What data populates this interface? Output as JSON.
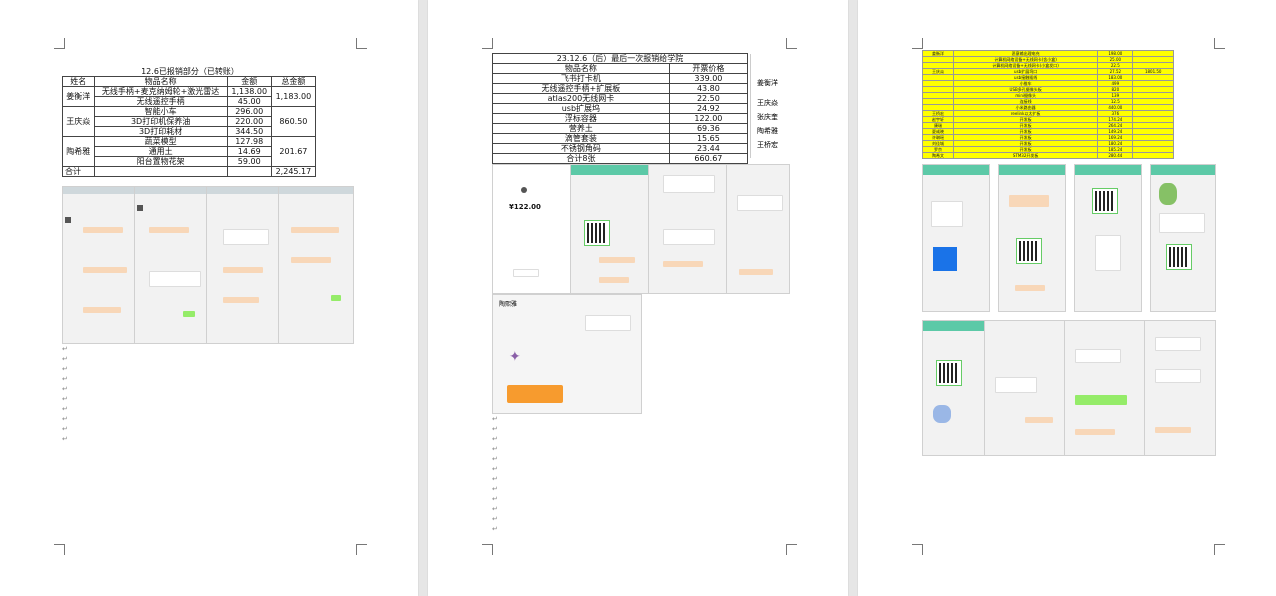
{
  "page1": {
    "caption": "12.6已报销部分（已转账）",
    "headers": [
      "姓名",
      "物品名称",
      "金额",
      "总金额"
    ],
    "rows": {
      "jiang": {
        "name": "姜衡洋",
        "items": [
          "无线手柄+麦克纳姆轮+激光雷达",
          "无线遥控手柄"
        ],
        "amounts": [
          "1,138.00",
          "45.00"
        ],
        "total": "1,183.00"
      },
      "wang": {
        "name": "王庆焱",
        "items": [
          "智能小车",
          "3D打印机保养油",
          "3D打印耗材"
        ],
        "amounts": [
          "296.00",
          "220.00",
          "344.50"
        ],
        "total": "860.50"
      },
      "tao": {
        "name": "陶希雅",
        "items": [
          "蔬菜模型",
          "通用土",
          "阳台置物花架"
        ],
        "amounts": [
          "127.98",
          "14.69",
          "59.00"
        ],
        "total": "201.67"
      },
      "sum_label": "合计",
      "sum_total": "2,245.17"
    }
  },
  "page2": {
    "caption": "23.12.6（后）最后一次报销给学院",
    "headers": [
      "物品名称",
      "开票价格"
    ],
    "items": [
      [
        "飞书打卡机",
        "339.00"
      ],
      [
        "无线遥控手柄+扩展板",
        "43.80"
      ],
      [
        "atlas200无线网卡",
        "22.50"
      ],
      [
        "usb扩展坞",
        "24.92"
      ],
      [
        "浮标容器",
        "122.00"
      ],
      [
        "营养土",
        "69.36"
      ],
      [
        "滴管套装",
        "15.65"
      ],
      [
        "不锈钢角码",
        "23.44"
      ],
      [
        "合计8张",
        "660.67"
      ]
    ],
    "side_names": [
      "姜衡洋",
      "王庆焱",
      "张庆奎",
      "陶希雅",
      "王桥宏"
    ],
    "payment_amount": "¥122.00",
    "chat_title": "陶熙雅"
  },
  "page3": {
    "rows": [
      [
        "姜衡洋",
        "恶意输出理电充",
        "198.00",
        ""
      ],
      [
        "",
        "计算机网络设备+无线网卡(含小盒)",
        "25.00",
        ""
      ],
      [
        "",
        "计算机网络设备+无线网卡(小盒发口)",
        "22.5",
        ""
      ],
      [
        "王庆焱",
        "usb扩展坞口",
        "27.52",
        "1801.50"
      ],
      [
        "",
        "usb接触插线",
        "183.00",
        ""
      ],
      [
        "",
        "小推车",
        "499",
        ""
      ],
      [
        "",
        "USB多孔摄像头板",
        "820",
        ""
      ],
      [
        "",
        "mini摄像头",
        "139",
        ""
      ],
      [
        "",
        "连接线",
        "12.5",
        ""
      ],
      [
        "",
        "小米路由器",
        "440.00",
        ""
      ],
      [
        "王桥宏",
        "reelink以太扩板",
        "376",
        ""
      ],
      [
        "赵宇轩",
        "开发板",
        "174.24",
        ""
      ],
      [
        "康瑞",
        "开发板",
        "264.24",
        ""
      ],
      [
        "夏彧晓",
        "开发板",
        "149.24",
        ""
      ],
      [
        "许琳瑶",
        "开发板",
        "169.24",
        ""
      ],
      [
        "刘佳城",
        "开发板",
        "180.24",
        ""
      ],
      [
        "罗京",
        "开发板",
        "185.24",
        ""
      ],
      [
        "陶希文",
        "STM32开发板",
        "280.44",
        ""
      ]
    ]
  }
}
